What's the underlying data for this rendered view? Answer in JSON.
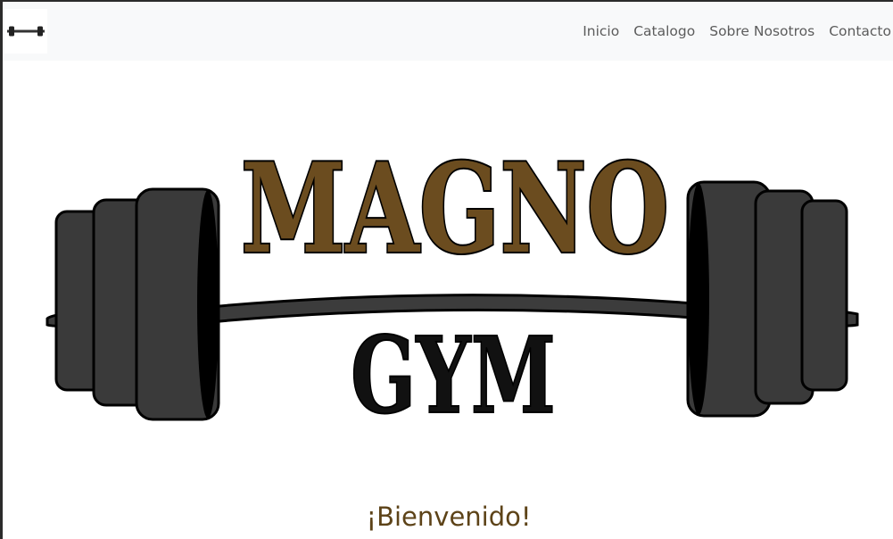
{
  "navbar": {
    "brand_icon": "barbell-icon",
    "links": [
      {
        "label": "Inicio"
      },
      {
        "label": "Catalogo"
      },
      {
        "label": "Sobre Nosotros"
      },
      {
        "label": "Contacto"
      }
    ]
  },
  "hero": {
    "logo_line1": "MAGNO",
    "logo_line2": "GYM",
    "logo_icon": "barbell-icon",
    "colors": {
      "magno_fill": "#6b4c1f",
      "gym_fill": "#111111",
      "plate_fill": "#3a3a3a"
    }
  },
  "welcome": {
    "heading": "¡Bienvenido!",
    "color": "#5d4318"
  }
}
